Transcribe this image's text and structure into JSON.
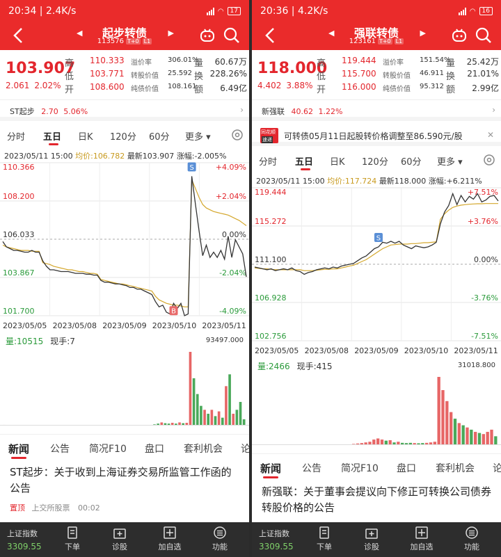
{
  "panels": [
    {
      "status": {
        "time": "20:34",
        "speed": "2.4K/s",
        "battery": "17"
      },
      "nav": {
        "title": "起步转债",
        "code": "113576",
        "tags": [
          "T+0",
          "L1"
        ]
      },
      "quote": {
        "price": "103.907",
        "change": "2.061",
        "change_pct": "2.02%",
        "high_label": "高",
        "high": "110.333",
        "low_label": "低",
        "low": "103.771",
        "open_label": "开",
        "open": "108.600",
        "premium_label": "溢价率",
        "premium": "306.01%",
        "conv_label": "转股价值",
        "conv_value": "25.592",
        "bond_label": "纯债价值",
        "bond_value": "108.161",
        "vol_label": "量",
        "volume": "60.67万",
        "turn_label": "换",
        "turnover": "228.26%",
        "amt_label": "额",
        "amount": "6.49亿"
      },
      "stock": {
        "name": "ST起步",
        "price": "2.70",
        "pct": "5.06%"
      },
      "notice": null,
      "periods": [
        "分时",
        "五日",
        "日K",
        "120分",
        "60分",
        "更多 ▾"
      ],
      "active_period": 1,
      "chart_info": {
        "datetime": "2023/05/11 15:00",
        "avg_label": "均价:106.782",
        "latest_label": "最新103.907",
        "pct_label": "涨幅:-2.005%"
      },
      "volume_info": {
        "vol_label": "量:10515",
        "hand_label": "现手:7",
        "max": "93497.000"
      },
      "news_tabs": [
        "新闻",
        "公告",
        "简况F10",
        "盘口",
        "套利机会",
        "论"
      ],
      "headline": "ST起步：关于收到上海证券交易所监管工作函的公告",
      "meta": {
        "pin": "置顶",
        "source": "上交所股票",
        "time": "00:02"
      }
    },
    {
      "status": {
        "time": "20:36",
        "speed": "4.2K/s",
        "battery": "16"
      },
      "nav": {
        "title": "强联转债",
        "code": "123161",
        "tags": [
          "T+0",
          "L1"
        ]
      },
      "quote": {
        "price": "118.000",
        "change": "4.402",
        "change_pct": "3.88%",
        "high_label": "高",
        "high": "119.444",
        "low_label": "低",
        "low": "115.700",
        "open_label": "开",
        "open": "116.000",
        "premium_label": "溢价率",
        "premium": "151.54%",
        "conv_label": "转股价值",
        "conv_value": "46.911",
        "bond_label": "纯债价值",
        "bond_value": "95.312",
        "vol_label": "量",
        "volume": "25.42万",
        "turn_label": "换",
        "turnover": "21.01%",
        "amt_label": "额",
        "amount": "2.99亿"
      },
      "stock": {
        "name": "新强联",
        "price": "40.62",
        "pct": "1.22%"
      },
      "notice": {
        "badge_top": "同花顺",
        "badge_bottom": "速递",
        "text": "可转债05月11日起股转价格调整至86.590元/股"
      },
      "periods": [
        "分时",
        "五日",
        "日K",
        "120分",
        "60分",
        "更多 ▾"
      ],
      "active_period": 1,
      "chart_info": {
        "datetime": "2023/05/11 15:00",
        "avg_label": "均价:117.724",
        "latest_label": "最新118.000",
        "pct_label": "涨幅:+6.211%"
      },
      "volume_info": {
        "vol_label": "量:2466",
        "hand_label": "现手:415",
        "max": "31018.800"
      },
      "news_tabs": [
        "新闻",
        "公告",
        "简况F10",
        "盘口",
        "套利机会",
        "论"
      ],
      "headline": "新强联：关于董事会提议向下修正可转换公司债券转股价格的公告",
      "meta": null
    }
  ],
  "chart_data": [
    {
      "type": "line",
      "title": "",
      "x_ticks": [
        "2023/05/05",
        "2023/05/08",
        "2023/05/09",
        "2023/05/10",
        "2023/05/11"
      ],
      "y_ticks_left": [
        "110.366",
        "108.200",
        "106.033",
        "103.867",
        "101.700"
      ],
      "y_ticks_right": [
        "+4.09%",
        "+2.04%",
        "0.00%",
        "-2.04%",
        "-4.09%"
      ],
      "ylim": [
        101.7,
        110.366
      ],
      "prev_close": 106.033,
      "series": [
        {
          "name": "price",
          "values": [
            105.9,
            105.6,
            105.5,
            105.4,
            105.4,
            105.35,
            105.3,
            105.3,
            105.4,
            105.3,
            105.3,
            104.8,
            104.5,
            104.3,
            104.3,
            104.25,
            104.2,
            104.2,
            104.2,
            104.15,
            104.1,
            104.1,
            104.1,
            104.05,
            104.05,
            104.0,
            104.0,
            103.7,
            103.6,
            103.6,
            103.55,
            103.5,
            103.5,
            103.45,
            103.4,
            103.3,
            103.3,
            103.2,
            103.2,
            103.1,
            103.0,
            102.9,
            102.5,
            102.2,
            102.3,
            101.9,
            101.8,
            102.4,
            102.1,
            102.4,
            101.7,
            101.8,
            109.6,
            108.0,
            106.5,
            105.1,
            105.7,
            105.0,
            105.3,
            105.0,
            105.4,
            104.9,
            106.2,
            105.0,
            106.0,
            105.6,
            105.2,
            103.9
          ]
        },
        {
          "name": "avg",
          "values": [
            105.7,
            105.6,
            105.55,
            105.5,
            105.45,
            105.4,
            105.4,
            105.4,
            105.35,
            105.35,
            105.35,
            104.7,
            104.65,
            104.6,
            104.5,
            104.45,
            104.4,
            104.35,
            104.3,
            104.3,
            104.25,
            104.2,
            104.2,
            104.15,
            104.1,
            104.1,
            104.05,
            103.75,
            103.7,
            103.65,
            103.6,
            103.55,
            103.5,
            103.5,
            103.45,
            103.4,
            103.35,
            103.3,
            103.25,
            103.2,
            103.15,
            103.1,
            102.8,
            102.6,
            102.5,
            102.4,
            102.35,
            102.3,
            102.3,
            102.25,
            102.2,
            102.2,
            109.4,
            108.9,
            108.4,
            108.0,
            107.8,
            107.7,
            107.6,
            107.55,
            107.5,
            107.45,
            107.4,
            107.3,
            107.2,
            107.1,
            106.95,
            106.8
          ]
        }
      ],
      "markers": [
        {
          "label": "S",
          "index": 52
        },
        {
          "label": "B",
          "index": 47
        }
      ],
      "volume": [
        900,
        600,
        500,
        400,
        300,
        300,
        250,
        250,
        200,
        200,
        300,
        500,
        400,
        300,
        300,
        250,
        250,
        200,
        200,
        200,
        200,
        200,
        200,
        250,
        200,
        200,
        300,
        400,
        300,
        300,
        300,
        250,
        250,
        250,
        200,
        250,
        300,
        300,
        350,
        400,
        500,
        700,
        1500,
        2500,
        4000,
        3000,
        2500,
        3500,
        2500,
        4000,
        3000,
        3500,
        93497,
        60000,
        40000,
        25000,
        20000,
        15000,
        20000,
        12000,
        18000,
        10000,
        50000,
        65000,
        15000,
        20000,
        30000,
        8000
      ]
    },
    {
      "type": "line",
      "title": "",
      "x_ticks": [
        "2023/05/05",
        "2023/05/08",
        "2023/05/09",
        "2023/05/10",
        "2023/05/11"
      ],
      "y_ticks_left": [
        "119.444",
        "115.272",
        "111.100",
        "106.928",
        "102.756"
      ],
      "y_ticks_right": [
        "+7.51%",
        "+3.76%",
        "0.00%",
        "-3.76%",
        "-7.51%"
      ],
      "ylim": [
        102.756,
        119.444
      ],
      "prev_close": 111.1,
      "series": [
        {
          "name": "price",
          "values": [
            110.8,
            110.7,
            110.6,
            110.5,
            110.6,
            110.4,
            110.5,
            110.6,
            110.5,
            110.7,
            110.4,
            110.3,
            110.0,
            110.2,
            110.3,
            110.5,
            110.6,
            110.7,
            110.6,
            110.8,
            110.7,
            110.9,
            111.0,
            111.1,
            111.2,
            111.5,
            111.8,
            112.0,
            112.4,
            112.8,
            113.0,
            113.5,
            113.4,
            113.6,
            113.4,
            113.6,
            113.2,
            113.0,
            112.8,
            113.1,
            113.0,
            112.9,
            113.0,
            113.2,
            113.5,
            115.5,
            116.8,
            117.5,
            118.8,
            117.6,
            118.6,
            117.9,
            118.5,
            118.2,
            118.8,
            117.9,
            118.1,
            118.5,
            118.6,
            118.0
          ]
        },
        {
          "name": "avg",
          "values": [
            110.7,
            110.65,
            110.6,
            110.6,
            110.55,
            110.5,
            110.5,
            110.5,
            110.5,
            110.5,
            110.5,
            110.5,
            110.4,
            110.4,
            110.4,
            110.45,
            110.5,
            110.55,
            110.55,
            110.6,
            110.6,
            110.7,
            110.8,
            110.9,
            111.0,
            111.2,
            111.4,
            111.6,
            111.9,
            112.2,
            112.5,
            112.8,
            113.0,
            113.2,
            113.25,
            113.3,
            113.3,
            113.3,
            113.35,
            113.35,
            113.4,
            113.45,
            113.45,
            113.5,
            113.55,
            116.0,
            116.6,
            117.0,
            117.3,
            117.45,
            117.55,
            117.6,
            117.65,
            117.68,
            117.7,
            117.7,
            117.72,
            117.72,
            117.72,
            117.724
          ]
        }
      ],
      "markers": [
        {
          "label": "S",
          "index": 30
        }
      ],
      "volume": [
        200,
        150,
        150,
        100,
        100,
        100,
        120,
        100,
        100,
        150,
        120,
        100,
        200,
        150,
        150,
        150,
        150,
        200,
        150,
        200,
        250,
        250,
        300,
        300,
        500,
        700,
        900,
        1200,
        1500,
        2500,
        3000,
        2500,
        2000,
        2200,
        1200,
        1500,
        1000,
        900,
        1000,
        900,
        800,
        900,
        1000,
        1200,
        1500,
        31018,
        25000,
        20000,
        15000,
        12000,
        10000,
        9000,
        8000,
        7000,
        6000,
        5500,
        5000,
        6000,
        7000,
        4000
      ]
    }
  ],
  "bottom_bar": {
    "index_label": "上证指数",
    "index_value": "3309.55",
    "items": [
      "下单",
      "诊股",
      "加自选",
      "功能"
    ]
  }
}
